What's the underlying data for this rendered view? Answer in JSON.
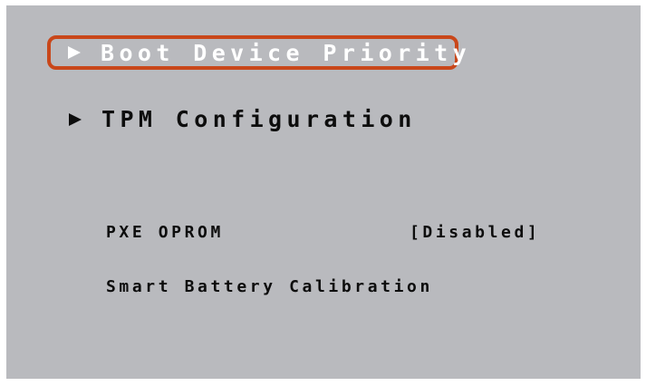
{
  "menu": {
    "items": [
      {
        "label": "Boot Device Priority",
        "selected": true,
        "icon": "triangle-right-icon"
      },
      {
        "label": "TPM Configuration",
        "selected": false,
        "icon": "triangle-right-icon"
      }
    ]
  },
  "settings": {
    "pxe_oprom": {
      "label": "PXE OPROM",
      "value": "[Disabled]"
    },
    "smart_battery": {
      "label": "Smart Battery Calibration"
    }
  },
  "colors": {
    "background": "#b9babe",
    "text": "#0d0d0d",
    "highlight_border": "#c9471a",
    "highlight_text": "#ffffff"
  }
}
